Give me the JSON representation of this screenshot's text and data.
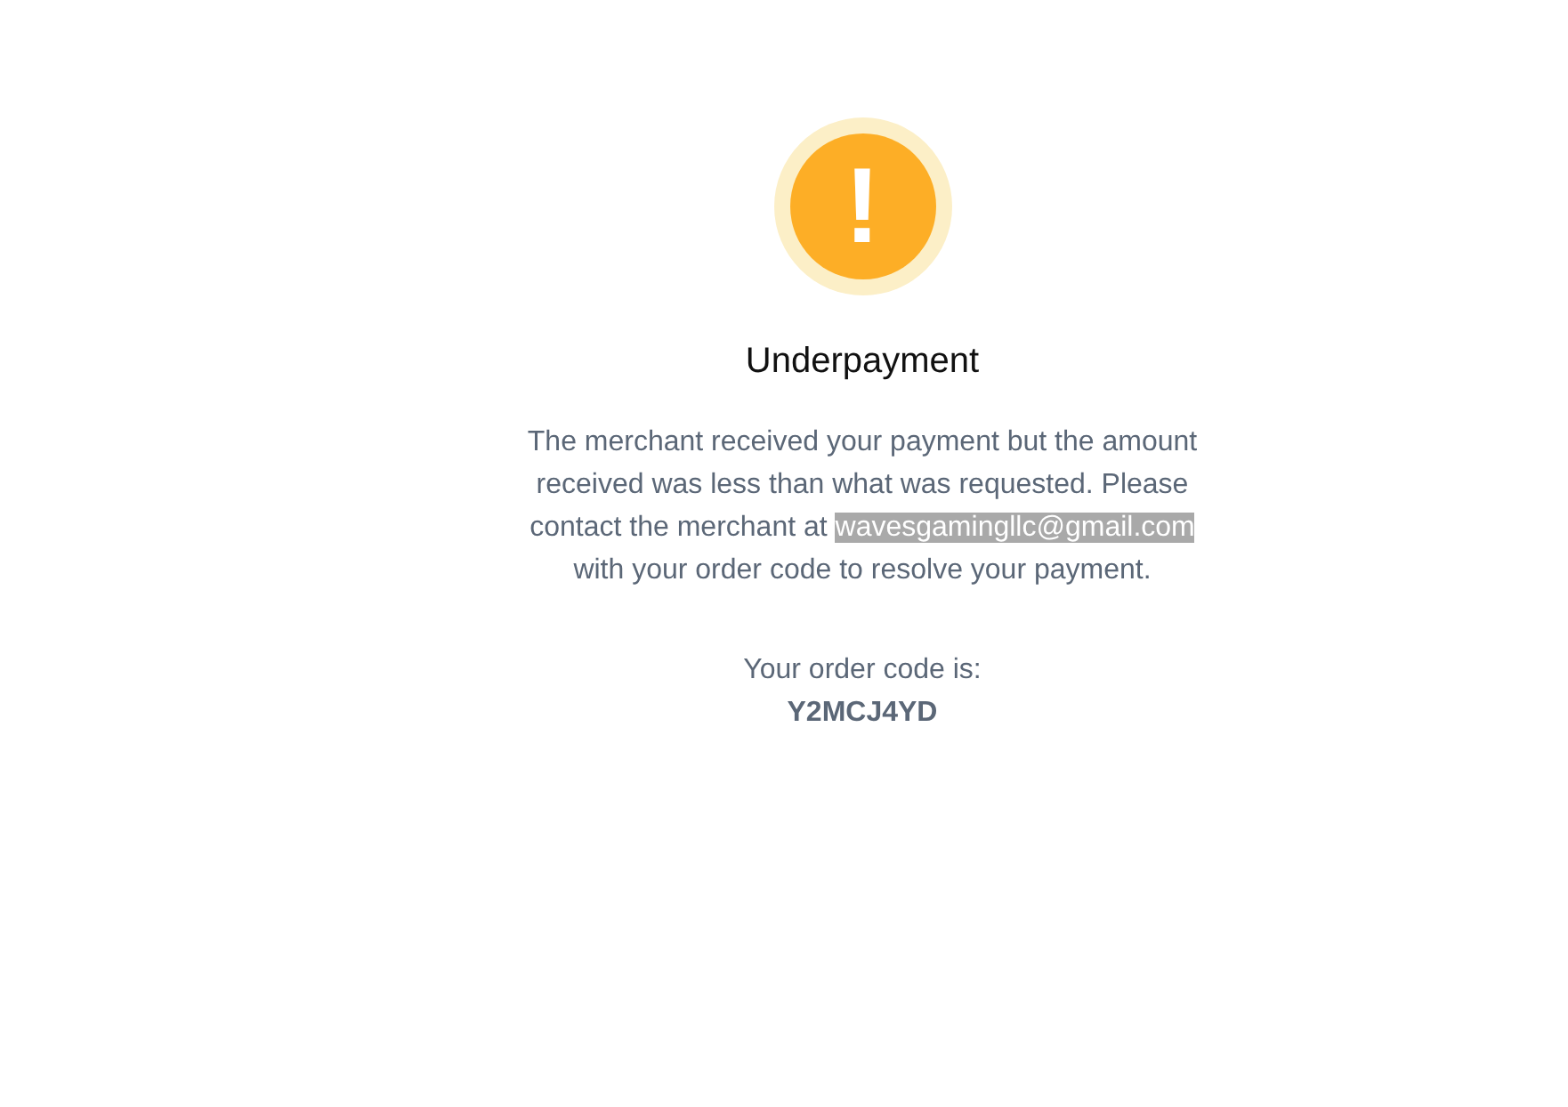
{
  "status_icon": {
    "symbol": "!"
  },
  "title": "Underpayment",
  "message": {
    "before": "The merchant received your payment but the amount received was less than what was requested. Please contact the merchant at ",
    "email": {
      "text": "wavesgamingllc@gmail.com",
      "selected": true
    },
    "after": " with your order code to resolve your payment."
  },
  "order_code": {
    "label": "Your order code is:",
    "code": "Y2MCJ4YD"
  }
}
